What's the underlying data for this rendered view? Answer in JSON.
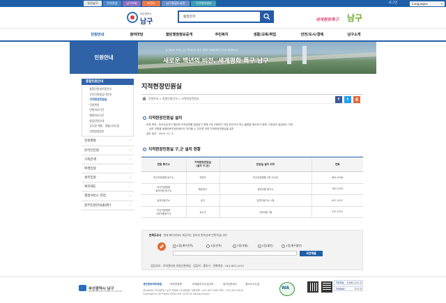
{
  "util": {
    "tabs": [
      "부산남구",
      "문화관광",
      "남구의회",
      "보건소",
      "남구종합도서관",
      "구민체육센터"
    ],
    "tab_colors": [
      "#e8e8e8",
      "#4b86c8",
      "#8b6ec0",
      "#ec7a46",
      "#6b8fc9",
      "#3ea0b1"
    ],
    "login": "로그인",
    "language": "Languages"
  },
  "header": {
    "logo_sub": "부산광역시",
    "logo_name": "남구",
    "search_value": "통합검색",
    "slogan_small": "세계평화특구",
    "slogan_big": "남구"
  },
  "gnb": {
    "items": [
      "민원안내",
      "참여마당",
      "열린행정정보공개",
      "주민복지",
      "생활/교육/취업",
      "안전/도시/경제",
      "남구소개"
    ]
  },
  "banner": {
    "side_title": "민원안내",
    "small": "A NEW ERA OF PEACE WE ARE MAKING FOR NAMGU",
    "caption": "새로운 백년의 비전, 세계평화 특구 남구"
  },
  "lnb": {
    "head": "종합민원안내",
    "subs": [
      "통합민원실이용안내",
      "무인민원발급기안내",
      "지적현장민원실",
      "민원편람",
      "민원처리기간",
      "행정처리시간",
      "발급민원안내",
      "공무원 채용 - 제출(사유)등",
      "민원법령정보"
    ],
    "active_index": 2,
    "mains": [
      "민원편람",
      "온라인민원",
      "가족관계",
      "여권민원",
      "세무민원",
      "복지제도",
      "행정서비스 헌장",
      "정부민원안내콜센터"
    ]
  },
  "content": {
    "title": "지적현장민원실",
    "breadcrumb": "민원안내 > 종합민원안내 > 지적현장민원실",
    "share": [
      {
        "label": "f",
        "color": "#3b5998"
      },
      {
        "label": "t",
        "color": "#1da1f2"
      },
      {
        "label": "⎙",
        "color": "#e3683a"
      }
    ],
    "section1": "지적현장민원실 설치",
    "bullets": [
      "운영 목적 : 토지소유자가 필요한 지적공부를 발급받기 위해 3개 구청까지 직접 찾아가야 하는 불편을 해소하기 위해, 구청에서 발급하는 지적",
      "공부 민원을 동행정복지센터에서도 처리할 수 있도록 하여 지적현장민원실을 설치",
      "설치 일자 : 2005. 11. 5."
    ],
    "section2": "지적현장민원실 구,군 설치 현황"
  },
  "table": {
    "headers": [
      "관할 동기소",
      "지적현장민원실\n(설치 구,군)",
      "민원실 설치 위치",
      "전화"
    ],
    "rows": [
      [
        "부산지방법원 동기소",
        "연제구",
        "부산지방법원 1층 104호",
        "665-4766"
      ],
      [
        "부산지방법원\n동부지원 동기소",
        "해운대구",
        "동부지원 동기소",
        "780-1293"
      ],
      [
        "남부산동기소",
        "남구",
        "남부산동기소 1층",
        "607-4747"
      ],
      [
        "부산지방법원\n서부지원동기소",
        "강서구",
        "서부지원 1층",
        "970-2337"
      ]
    ]
  },
  "survey": {
    "question": "현재 페이지에서 제공하는 정보와 편의성에 만족하십니까?",
    "label": "만족도조사",
    "options": [
      "5점(매우만족)",
      "4점(만족)",
      "3점(보통)",
      "2점(불만)",
      "1점(매우불만)"
    ],
    "submit": "의견제출",
    "contact": "· 담당부서 : 토지관리과 부동산관리팀   · 담당자 : 홍추가   · 전화번호 : 051-607-4747"
  },
  "footer": {
    "logo_name": "부산광역시 남구",
    "logo_en": "BUSAN METROPOLITAN CITY NAM-GU",
    "links": [
      "개인정보처리방침",
      "저작권정책",
      "이메일무단수집거부",
      "뷰어다운로드",
      "찾아오시는길"
    ],
    "address1": "(우)48452 부산광역시 남구 못골로 19(대연동)   대표전화 : 051-607-4000   팩스 : 051-607-4444",
    "address2": "Copyright(c) All Rights Reserved. 2016 by Namgu Busan",
    "counts": [
      {
        "label": "TOTAL",
        "value": "6,585,210",
        "unit": "명"
      },
      {
        "label": "TODAY",
        "value": "373",
        "unit": "명"
      }
    ]
  }
}
